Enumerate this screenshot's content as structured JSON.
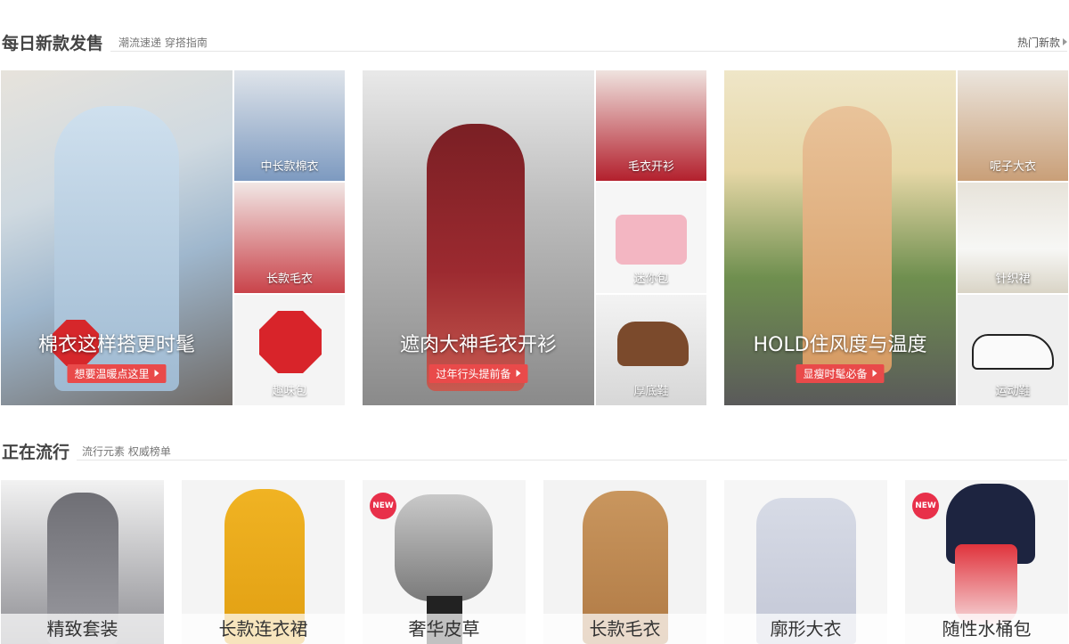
{
  "section1": {
    "title": "每日新款发售",
    "subtitle": "潮流速递 穿搭指南",
    "more": "热门新款"
  },
  "section2": {
    "title": "正在流行",
    "subtitle": "流行元素 权威榜单"
  },
  "groups": [
    {
      "caption": "棉衣这样搭更时髦",
      "cta": "想要温暖点这里",
      "tiles": [
        "中长款棉衣",
        "长款毛衣",
        "趣味包"
      ]
    },
    {
      "caption": "遮肉大神毛衣开衫",
      "cta": "过年行头提前备",
      "tiles": [
        "毛衣开衫",
        "迷你包",
        "厚底鞋"
      ]
    },
    {
      "caption": "HOLD住风度与温度",
      "cta": "显瘦时髦必备",
      "tiles": [
        "呢子大衣",
        "针织裙",
        "运动鞋"
      ]
    }
  ],
  "trending": [
    {
      "label": "精致套装"
    },
    {
      "label": "长款连衣裙"
    },
    {
      "label": "奢华皮草",
      "badge": "NEW"
    },
    {
      "label": "长款毛衣"
    },
    {
      "label": "廓形大衣"
    },
    {
      "label": "随性水桶包",
      "badge": "NEW"
    }
  ],
  "icons": {
    "more_arrow": "triangle-right-icon",
    "cta_arrow": "triangle-right-icon"
  },
  "colors": {
    "accent": "#e94a4a",
    "new_badge": "#e8304a"
  }
}
